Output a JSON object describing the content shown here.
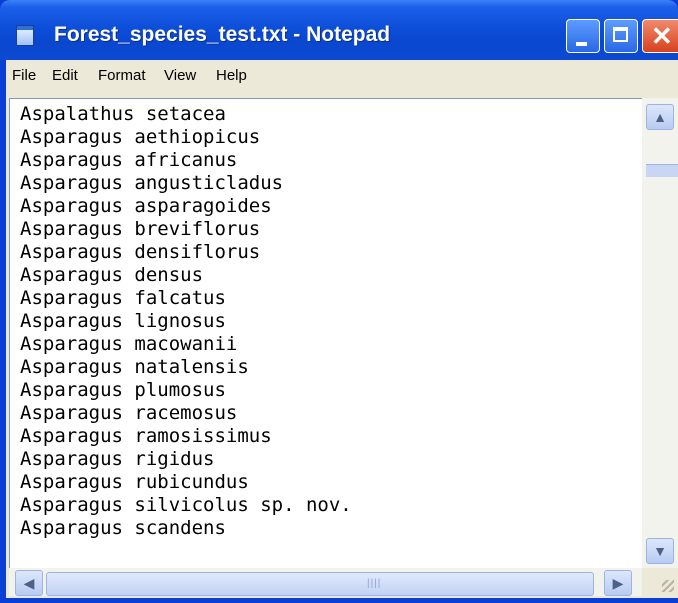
{
  "window": {
    "title": "Forest_species_test.txt - Notepad",
    "icon": "notepad-icon",
    "controls": [
      "minimize-icon",
      "maximize-icon",
      "close-icon"
    ]
  },
  "menu": {
    "items": [
      "File",
      "Edit",
      "Format",
      "View",
      "Help"
    ]
  },
  "editor": {
    "lines": [
      "Aspalathus setacea",
      "Asparagus aethiopicus",
      "Asparagus africanus",
      "Asparagus angusticladus",
      "Asparagus asparagoides",
      "Asparagus breviflorus",
      "Asparagus densiflorus",
      "Asparagus densus",
      "Asparagus falcatus",
      "Asparagus lignosus",
      "Asparagus macowanii",
      "Asparagus natalensis",
      "Asparagus plumosus",
      "Asparagus racemosus",
      "Asparagus ramosissimus",
      "Asparagus rigidus",
      "Asparagus rubicundus",
      "Asparagus silvicolus sp. nov.",
      "Asparagus scandens"
    ]
  },
  "colors": {
    "titlebar": "#0a47cf",
    "menubar": "#ece9d8",
    "editor_bg": "#ffffff"
  }
}
